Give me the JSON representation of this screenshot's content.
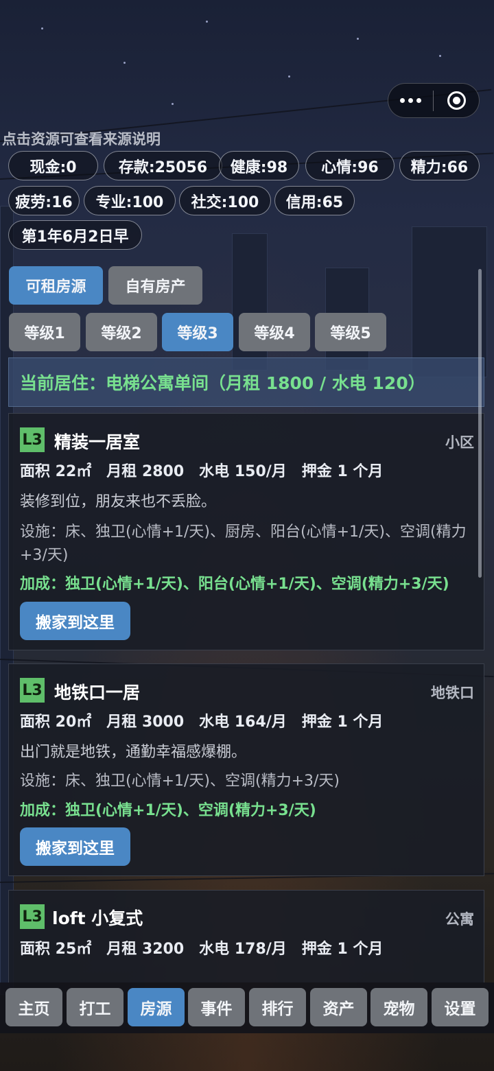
{
  "hint": "点击资源可查看来源说明",
  "stats": [
    {
      "label": "现金:0"
    },
    {
      "label": "存款:25056"
    },
    {
      "label": "健康:98"
    },
    {
      "label": "心情:96"
    },
    {
      "label": "精力:66"
    },
    {
      "label": "疲劳:16"
    },
    {
      "label": "专业:100"
    },
    {
      "label": "社交:100"
    },
    {
      "label": "信用:65"
    },
    {
      "label": "第1年6月2日早"
    }
  ],
  "source_tabs": [
    "可租房源",
    "自有房产"
  ],
  "level_tabs": [
    "等级1",
    "等级2",
    "等级3",
    "等级4",
    "等级5"
  ],
  "current_residence": "当前居住：电梯公寓单间（月租 1800 / 水电 120）",
  "listings": [
    {
      "level": "L3",
      "title": "精装一居室",
      "tag": "小区",
      "specs": [
        "面积 22㎡",
        "月租 2800",
        "水电 150/月",
        "押金 1 个月"
      ],
      "desc": "装修到位，朋友来也不丢脸。",
      "facilities": "设施：床、独卫(心情+1/天)、厨房、阳台(心情+1/天)、空调(精力+3/天)",
      "bonus": "加成：独卫(心情+1/天)、阳台(心情+1/天)、空调(精力+3/天)",
      "action": "搬家到这里"
    },
    {
      "level": "L3",
      "title": "地铁口一居",
      "tag": "地铁口",
      "specs": [
        "面积 20㎡",
        "月租 3000",
        "水电 164/月",
        "押金 1 个月"
      ],
      "desc": "出门就是地铁，通勤幸福感爆棚。",
      "facilities": "设施：床、独卫(心情+1/天)、空调(精力+3/天)",
      "bonus": "加成：独卫(心情+1/天)、空调(精力+3/天)",
      "action": "搬家到这里"
    },
    {
      "level": "L3",
      "title": "loft 小复式",
      "tag": "公寓",
      "specs": [
        "面积 25㎡",
        "月租 3200",
        "水电 178/月",
        "押金 1 个月"
      ]
    }
  ],
  "nav": [
    "主页",
    "打工",
    "房源",
    "事件",
    "排行",
    "资产",
    "宠物",
    "设置"
  ],
  "colors": {
    "accent": "#4a87c4",
    "inactive": "#6f7379",
    "bonus": "#78e08f",
    "badge": "#5fbe6a"
  }
}
